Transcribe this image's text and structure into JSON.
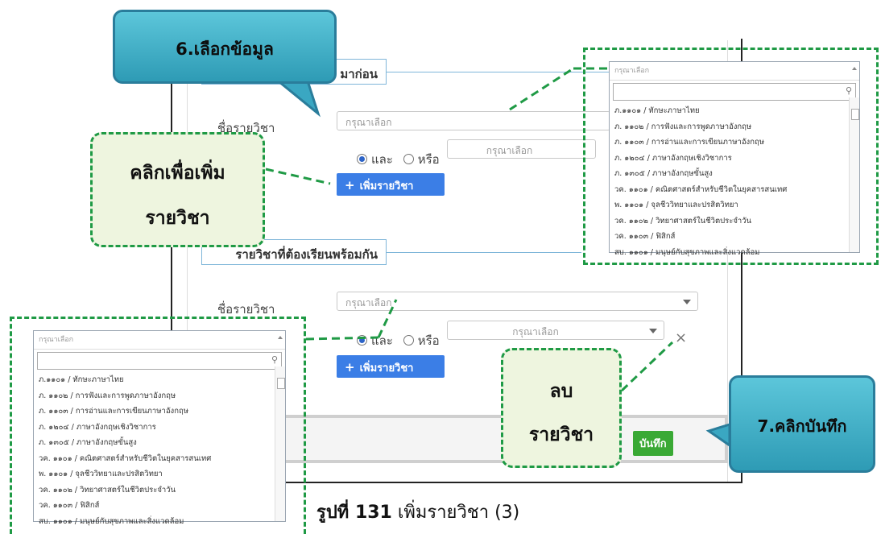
{
  "section1": {
    "title": "มาก่อน"
  },
  "section2": {
    "title": "รายวิชาที่ต้องเรียนพร้อมกัน"
  },
  "form": {
    "subject_label": "ชื่อรายวิชา",
    "placeholder": "กรุณาเลือก",
    "and_label": "และ",
    "or_label": "หรือ",
    "add_button": "เพิ่มรายวิชา",
    "save_button": "บันทึก",
    "close_glyph": "×"
  },
  "dropdown": {
    "header": "กรุณาเลือก",
    "options": [
      "ภ.๑๑๐๑ / ทักษะภาษาไทย",
      "ภ. ๑๑๐๒ / การฟังและการพูดภาษาอังกฤษ",
      "ภ. ๑๑๐๓ / การอ่านและการเขียนภาษาอังกฤษ",
      "ภ. ๑๒๐๔ / ภาษาอังกฤษเชิงวิชาการ",
      "ภ. ๑๓๐๕ / ภาษาอังกฤษขั้นสูง",
      "วค. ๑๑๐๑ / คณิตศาสตร์สำหรับชีวิตในยุคสารสนเทศ",
      "พ. ๑๑๐๑ / จุลชีววิทยาและปรสิตวิทยา",
      "วค. ๑๑๐๒ / วิทยาศาสตร์ในชีวิตประจำวัน",
      "วค. ๑๑๐๓ / ฟิสิกส์",
      "สบ. ๑๑๐๑ / มนุษย์กับสุขภาพและสิ่งแวดล้อม"
    ]
  },
  "callouts": {
    "select_data": "6.เลือกข้อมูล",
    "click_add_line1": "คลิกเพื่อเพิ่ม",
    "click_add_line2": "รายวิชา",
    "delete_line1": "ลบ",
    "delete_line2": "รายวิชา",
    "click_save": "7.คลิกบันทึก"
  },
  "caption": {
    "prefix": "รูปที่ 131",
    "text": " เพิ่มรายวิชา (3)"
  },
  "colors": {
    "accent_blue": "#3b7ee6",
    "save_green": "#3aa935",
    "dash_green": "#1f9a45",
    "callout_blue": "#2e9bb5"
  }
}
